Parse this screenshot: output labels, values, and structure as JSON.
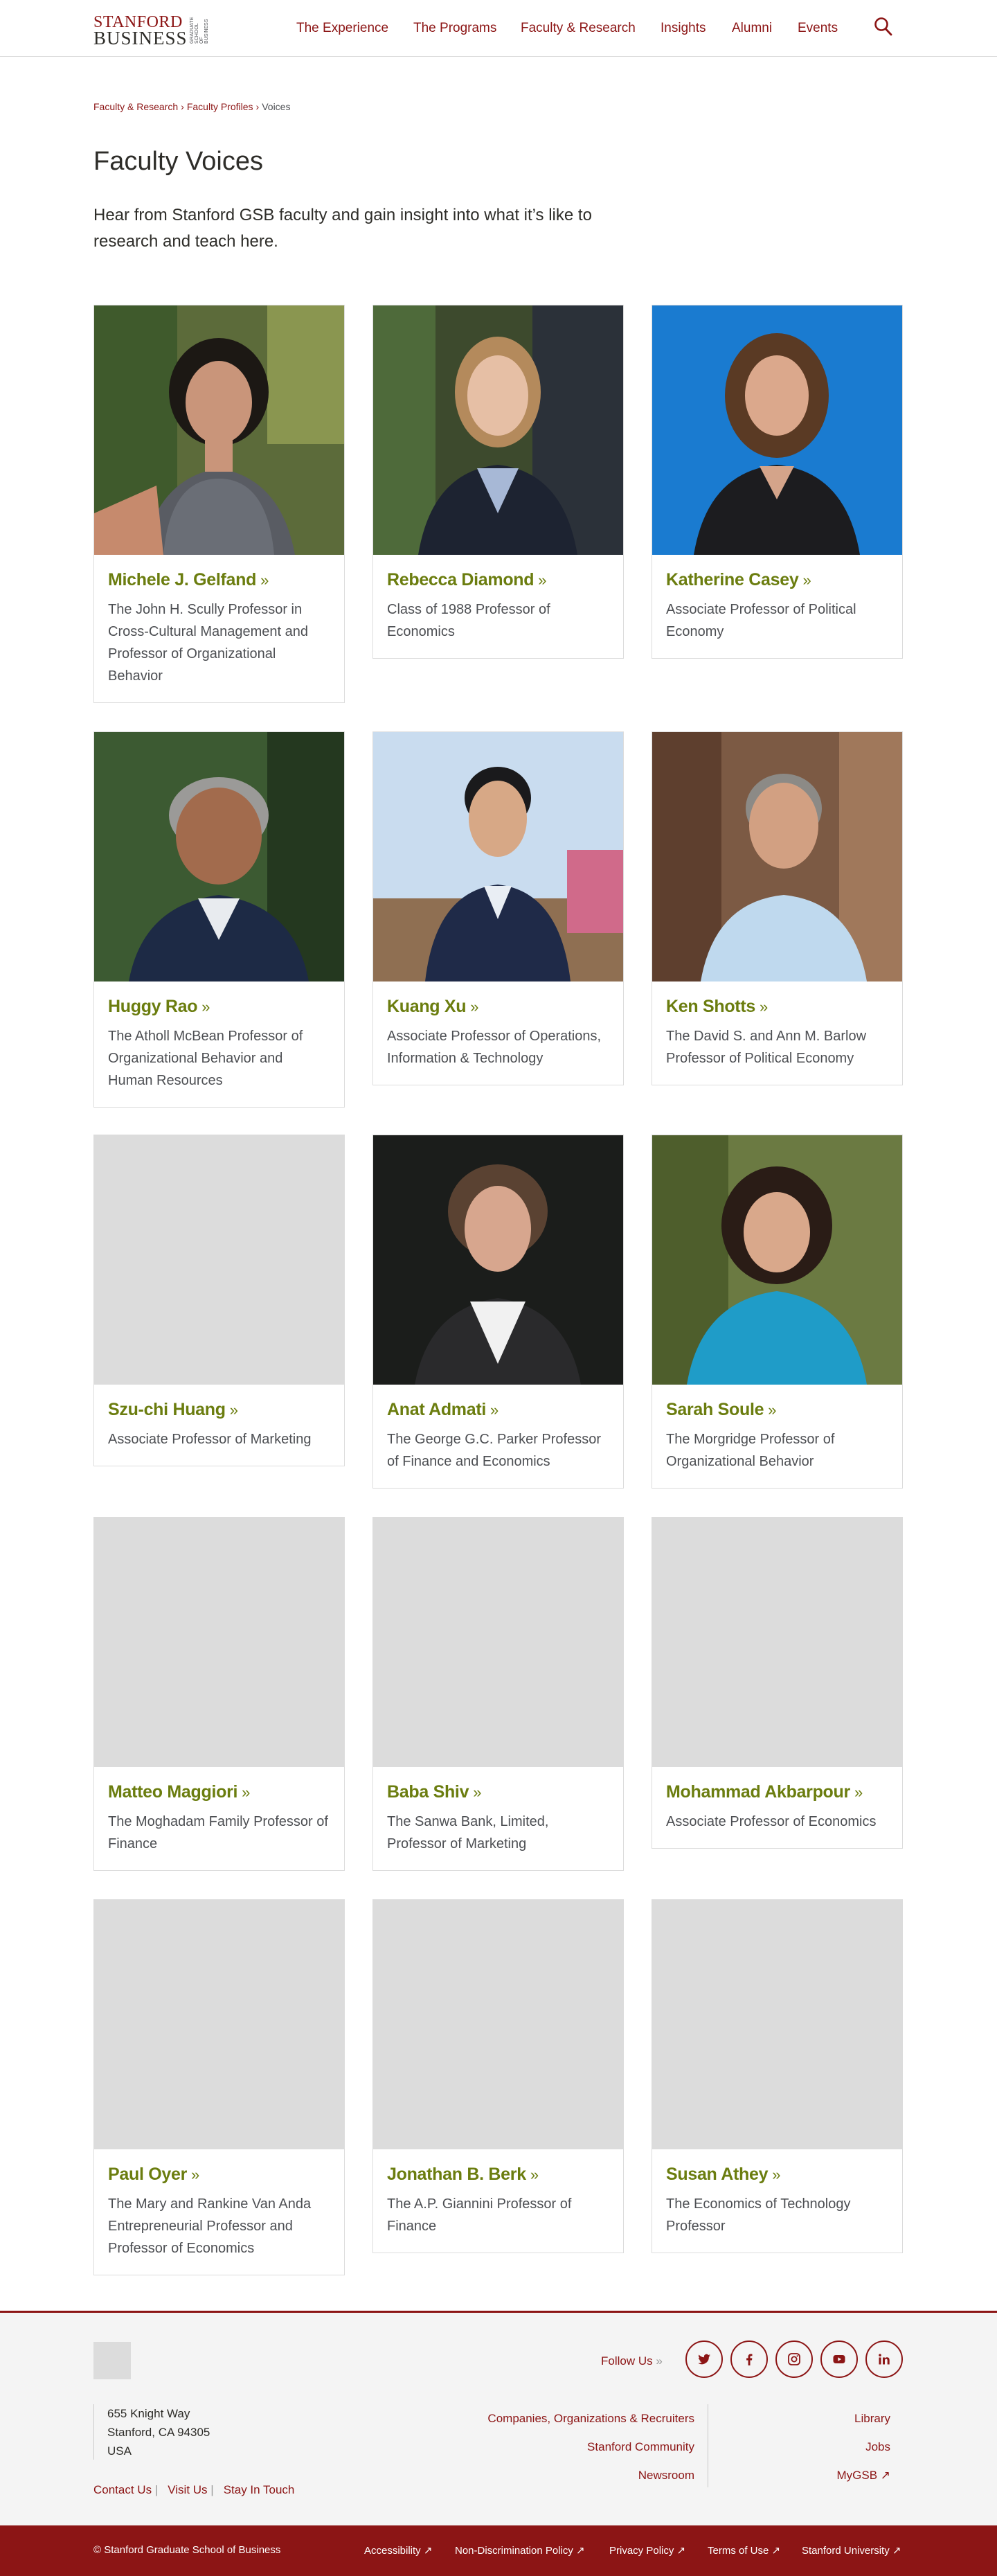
{
  "header": {
    "logo": {
      "line1": "STANFORD",
      "line2": "BUSINESS",
      "side": "GRADUATE SCHOOL OF BUSINESS"
    },
    "nav": [
      "The Experience",
      "The Programs",
      "Faculty & Research",
      "Insights",
      "Alumni",
      "Events"
    ],
    "search_icon": "search-icon"
  },
  "breadcrumb": {
    "items": [
      "Faculty & Research",
      "Faculty Profiles"
    ],
    "separator": "›",
    "current": "Voices"
  },
  "page": {
    "title": "Faculty Voices",
    "intro": "Hear from Stanford GSB faculty and gain insight into what it’s like to research and teach here."
  },
  "colors": {
    "brand": "#8c1515",
    "name_green": "#6b7d0f",
    "placeholder": "#dcdcdc"
  },
  "faculty": [
    {
      "name": "Michele J. Gelfand",
      "title": "The John H. Scully Professor in Cross-Cultural Management and Professor of Organizational Behavior",
      "photo": "portrait"
    },
    {
      "name": "Rebecca Diamond",
      "title": "Class of 1988 Professor of Economics",
      "photo": "portrait"
    },
    {
      "name": "Katherine Casey",
      "title": "Associate Professor of Political Economy",
      "photo": "portrait"
    },
    {
      "name": "Huggy Rao",
      "title": "The Atholl McBean Professor of Organizational Behavior and Human Resources",
      "photo": "portrait"
    },
    {
      "name": "Kuang Xu",
      "title": "Associate Professor of Operations, Information & Technology",
      "photo": "portrait"
    },
    {
      "name": "Ken Shotts",
      "title": "The David S. and Ann M. Barlow Professor of Political Economy",
      "photo": "portrait"
    },
    {
      "name": "Szu-chi Huang",
      "title": "Associate Professor of Marketing",
      "photo": "placeholder"
    },
    {
      "name": "Anat Admati",
      "title": "The George G.C. Parker Professor of Finance and Economics",
      "photo": "portrait"
    },
    {
      "name": "Sarah Soule",
      "title": "The Morgridge Professor of Organizational Behavior",
      "photo": "portrait"
    },
    {
      "name": "Matteo Maggiori",
      "title": "The Moghadam Family Professor of Finance",
      "photo": "placeholder"
    },
    {
      "name": "Baba Shiv",
      "title": "The Sanwa Bank, Limited, Professor of Marketing",
      "photo": "placeholder"
    },
    {
      "name": "Mohammad Akbarpour",
      "title": "Associate Professor of Economics",
      "photo": "placeholder"
    },
    {
      "name": "Paul Oyer",
      "title": "The Mary and Rankine Van Anda Entrepreneurial Professor and Professor of Economics",
      "photo": "placeholder"
    },
    {
      "name": "Jonathan B. Berk",
      "title": "The A.P. Giannini Professor of Finance",
      "photo": "placeholder"
    },
    {
      "name": "Susan Athey",
      "title": "The Economics of Technology Professor",
      "photo": "placeholder"
    }
  ],
  "chevron": "»",
  "footer": {
    "follow_label": "Follow Us",
    "follow_chevron": "»",
    "social": [
      "twitter-icon",
      "facebook-icon",
      "instagram-icon",
      "youtube-icon",
      "linkedin-icon"
    ],
    "address": [
      "655 Knight Way",
      "Stanford, CA 94305",
      "USA"
    ],
    "links": [
      "Contact Us",
      "Visit Us",
      "Stay In Touch"
    ],
    "middle_links": [
      "Companies, Organizations & Recruiters",
      "Stanford Community",
      "Newsroom"
    ],
    "right_links": [
      "Library",
      "Jobs",
      "MyGSB ↗"
    ]
  },
  "bottom_bar": {
    "copyright": "© Stanford Graduate School of Business",
    "links": [
      "Accessibility ↗",
      "Non-Discrimination Policy ↗",
      "Privacy Policy ↗",
      "Terms of Use ↗",
      "Stanford University ↗"
    ]
  }
}
